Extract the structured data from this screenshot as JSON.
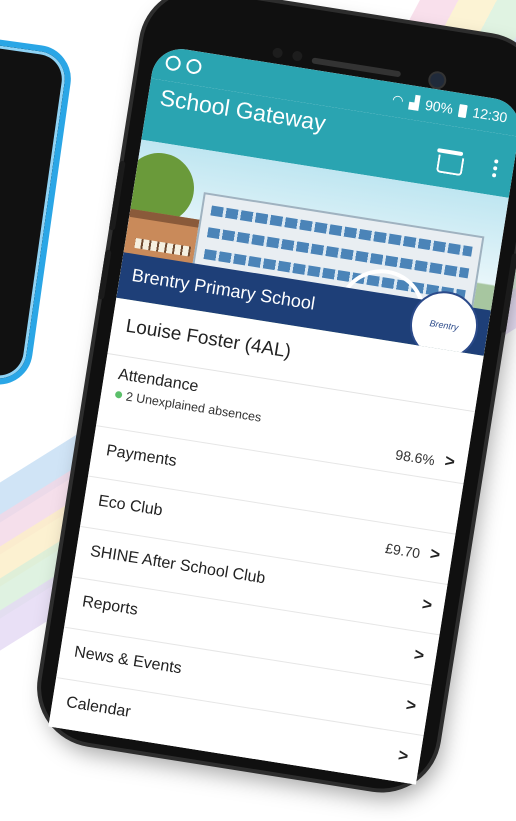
{
  "status_bar": {
    "signal_text": "∂ …",
    "battery": "90%",
    "time": "12:30"
  },
  "app_bar": {
    "title": "School Gateway"
  },
  "banner": {
    "school_name": "Brentry Primary School",
    "logo_text": "Brentry"
  },
  "pupil": {
    "name": "Louise Foster (4AL)"
  },
  "menu": {
    "attendance": {
      "label": "Attendance",
      "sub": "2 Unexplained absences",
      "value": "98.6%"
    },
    "payments": {
      "label": "Payments"
    },
    "eco_club": {
      "label": "Eco Club",
      "value": "£9.70"
    },
    "shine": {
      "label": "SHINE After School Club"
    },
    "reports": {
      "label": "Reports"
    },
    "news": {
      "label": "News & Events"
    },
    "calendar": {
      "label": "Calendar"
    }
  },
  "chevron": ">",
  "colors": {
    "app_bar": "#2aa4b1",
    "school_bar": "#1e3f78",
    "status_dot": "#5bbf6a"
  }
}
